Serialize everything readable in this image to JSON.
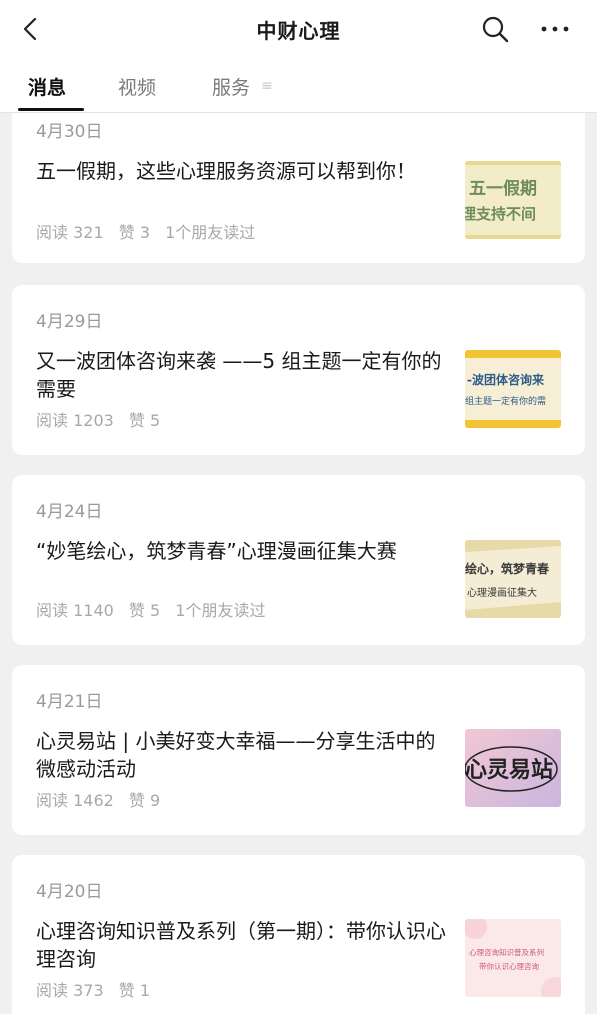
{
  "header": {
    "title": "中财心理",
    "back_icon": "chevron-left-icon",
    "search_icon": "search-icon",
    "more_icon": "more-horizontal-icon"
  },
  "tabs": [
    {
      "label": "消息",
      "active": true
    },
    {
      "label": "视频",
      "active": false
    },
    {
      "label": "服务",
      "active": false
    }
  ],
  "tab_extra": "≡",
  "articles": [
    {
      "date": "4月30日",
      "title": "五一假期，这些心理服务资源可以帮到你！",
      "read": "阅读 321",
      "likes": "赞 3",
      "friends": "1个朋友读过",
      "thumb": {
        "line1": "五一假期",
        "line2": "理支持不间",
        "bg": "#f3ecc8",
        "text_color": "#6e8c5c"
      }
    },
    {
      "date": "4月29日",
      "title": "又一波团体咨询来袭 ——5 组主题一定有你的需要",
      "read": "阅读 1203",
      "likes": "赞 5",
      "friends": "",
      "thumb": {
        "line1": "-波团体咨询来",
        "line2": "组主题一定有你的需",
        "bg": "#f6efd6",
        "text_color": "#2e5b8a"
      }
    },
    {
      "date": "4月24日",
      "title": "“妙笔绘心，筑梦青春”心理漫画征集大赛",
      "read": "阅读 1140",
      "likes": "赞 5",
      "friends": "1个朋友读过",
      "thumb": {
        "line1": "绘心，筑梦青春",
        "line2": "心理漫画征集大",
        "bg": "#f4ecd4",
        "text_color": "#3a3a3a"
      }
    },
    {
      "date": "4月21日",
      "title": "心灵易站 | 小美好变大幸福——分享生活中的微感动活动",
      "read": "阅读 1462",
      "likes": "赞 9",
      "friends": "",
      "thumb": {
        "line1": "心灵易站",
        "line2": "",
        "bg": "#eec2cf",
        "text_color": "#222222"
      }
    },
    {
      "date": "4月20日",
      "title": "心理咨询知识普及系列（第一期）：带你认识心理咨询",
      "read": "阅读 373",
      "likes": "赞 1",
      "friends": "",
      "thumb": {
        "line1": "心理咨询知识普及系列",
        "line2": "带你认识心理咨询",
        "bg": "#fbe9ea",
        "text_color": "#c7597a"
      }
    }
  ]
}
